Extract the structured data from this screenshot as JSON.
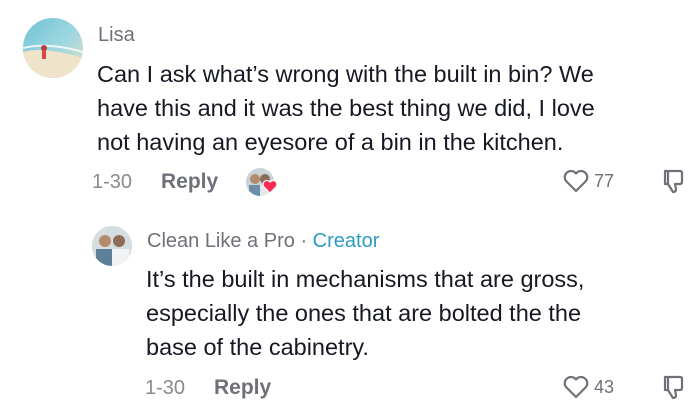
{
  "comment1": {
    "author": "Lisa",
    "text_lines": [
      "Can I ask what’s wrong with the built in bin? We",
      "have this and it was the best thing we did, I love",
      "not having an eyesore of a bin in the kitchen."
    ],
    "date": "1-30",
    "reply_label": "Reply",
    "like_count": "77"
  },
  "comment2": {
    "author": "Clean Like a Pro",
    "separator": "·",
    "badge": "Creator",
    "text_lines": [
      "It’s the built in mechanisms that are gross,",
      "especially the ones that are bolted the the",
      "base of the cabinetry."
    ],
    "date": "1-30",
    "reply_label": "Reply",
    "like_count": "43"
  },
  "colors": {
    "creator_badge": "#2c9cc0",
    "reaction_heart": "#fe2c55",
    "muted_text": "#6f7178"
  }
}
